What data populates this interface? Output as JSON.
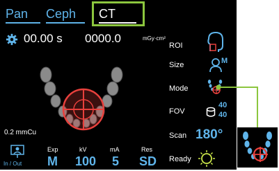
{
  "tabs": [
    {
      "label": "Pan"
    },
    {
      "label": "Ceph"
    },
    {
      "label": "CT"
    }
  ],
  "status": {
    "time": "00.00 s",
    "dose": "0000.0",
    "dose_unit": "mGy·cm²",
    "slice": "0.2 mmCu"
  },
  "exposure": {
    "in_out_label": "In / Out",
    "exp_label": "Exp",
    "exp_value": "M",
    "kv_label": "kV",
    "kv_value": "100",
    "ma_label": "mA",
    "ma_value": "5",
    "res_label": "Res",
    "res_value": "SD"
  },
  "settings": {
    "roi_label": "ROI",
    "size_label": "Size",
    "size_badge": "M",
    "mode_label": "Mode",
    "fov_label": "FOV",
    "fov_value_top": "40",
    "fov_value_bottom": "40",
    "scan_label": "Scan",
    "scan_value": "180°",
    "ready_label": "Ready"
  },
  "colors": {
    "accent_blue": "#5fb4ea",
    "highlight_green": "#8cc63e",
    "target_red": "#e8403c"
  },
  "icons": [
    "gear-icon",
    "jaw-arch-icon",
    "in-out-icon",
    "roi-head-icon",
    "size-head-icon",
    "mode-arch-icon",
    "fov-cylinder-icon",
    "ready-indicator-icon"
  ]
}
